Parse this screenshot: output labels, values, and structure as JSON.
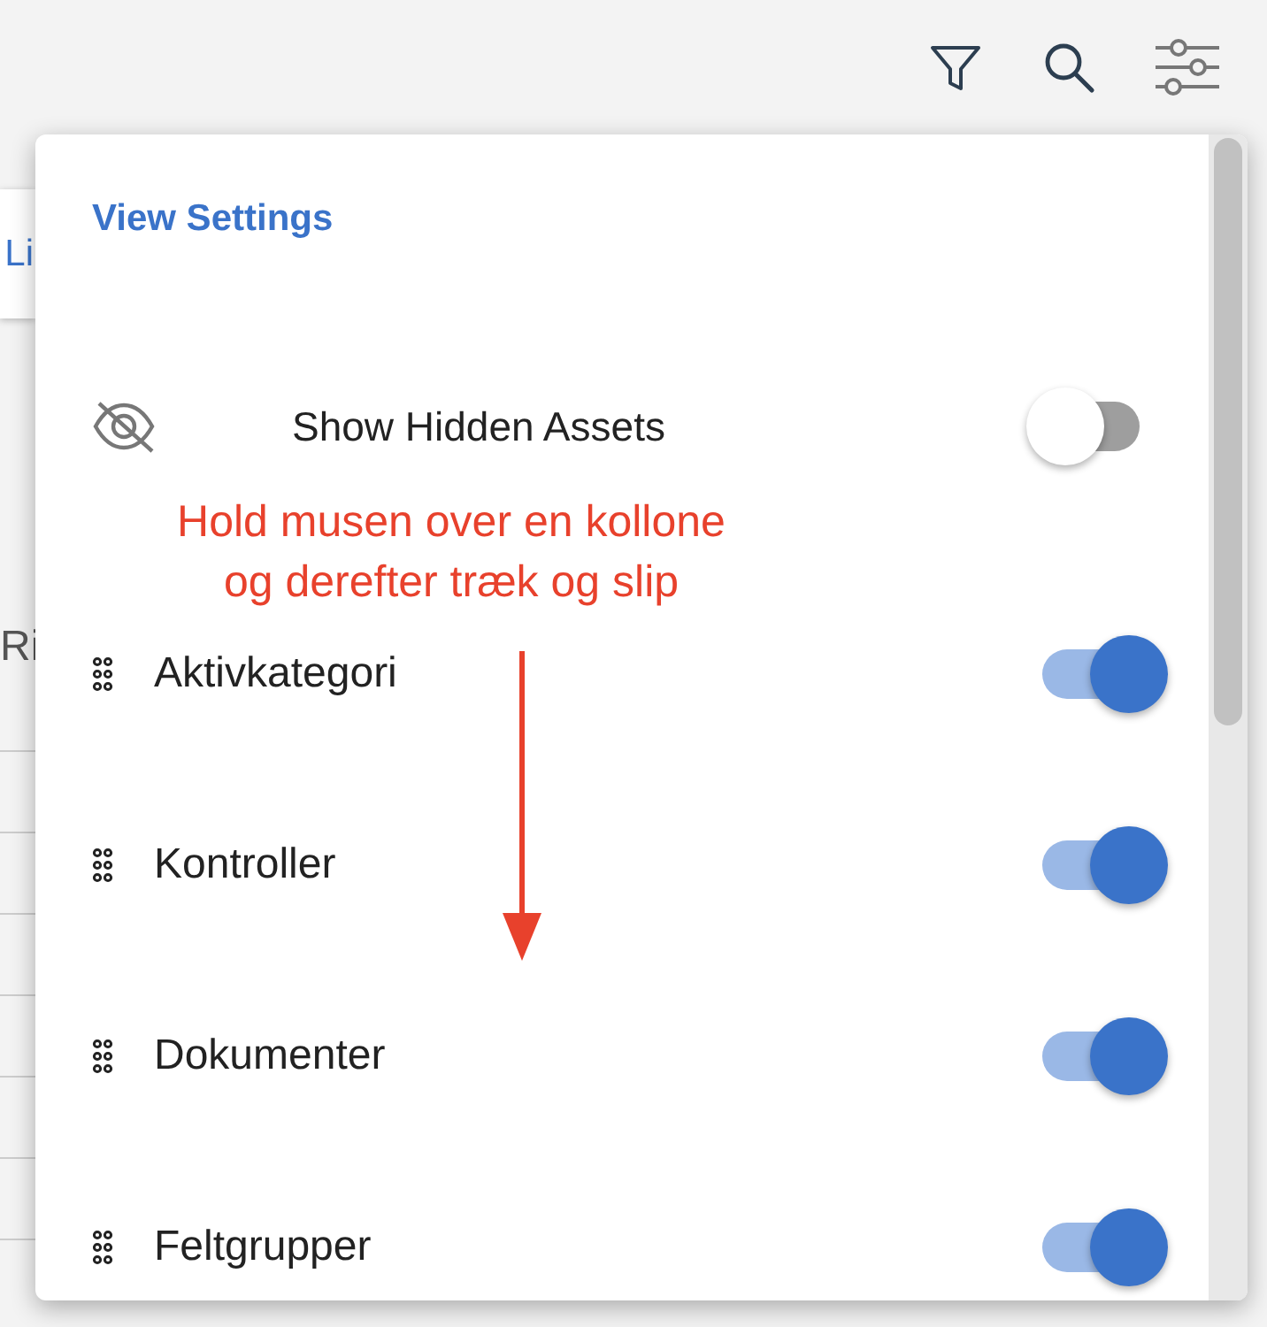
{
  "background": {
    "tab_label": "Li",
    "row_label": "Ri"
  },
  "panel": {
    "title": "View Settings",
    "hidden_assets": {
      "label": "Show Hidden Assets",
      "on": false
    },
    "columns": [
      {
        "label": "Aktivkategori",
        "on": true
      },
      {
        "label": "Kontroller",
        "on": true
      },
      {
        "label": "Dokumenter",
        "on": true
      },
      {
        "label": "Feltgrupper",
        "on": true
      }
    ]
  },
  "annotation": {
    "lines": [
      "Hold musen over en kollone",
      "og derefter træk og slip"
    ]
  }
}
